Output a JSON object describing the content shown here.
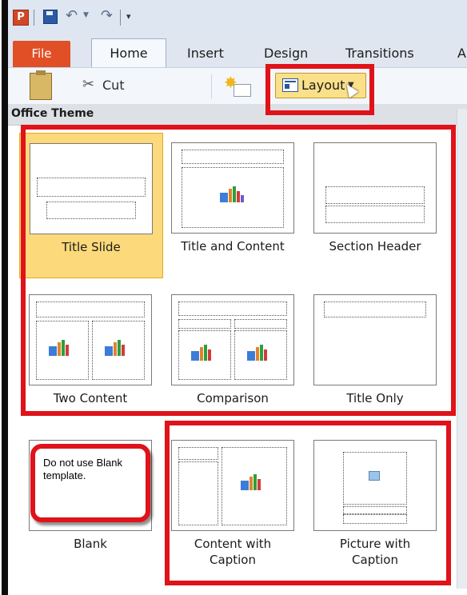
{
  "tabs": {
    "file": "File",
    "home": "Home",
    "insert": "Insert",
    "design": "Design",
    "transitions": "Transitions",
    "partial": "A"
  },
  "ribbon": {
    "cut_label": "Cut",
    "layout_label": "Layout"
  },
  "gallery": {
    "title": "Office Theme",
    "layouts": [
      {
        "label": "Title Slide",
        "selected": true
      },
      {
        "label": "Title and Content",
        "selected": false
      },
      {
        "label": "Section Header",
        "selected": false
      },
      {
        "label": "Two Content",
        "selected": false
      },
      {
        "label": "Comparison",
        "selected": false
      },
      {
        "label": "Title Only",
        "selected": false
      },
      {
        "label": "Blank",
        "selected": false
      },
      {
        "label": "Content with Caption",
        "selected": false
      },
      {
        "label": "Picture with Caption",
        "selected": false
      }
    ]
  },
  "annotation": {
    "callout_text": "Do not use Blank template."
  },
  "colors": {
    "highlight_red": "#e0121a",
    "selected_tile": "#fcd97a",
    "file_tab": "#e14f27"
  },
  "icons": [
    "powerpoint-app-icon",
    "save-icon",
    "undo-icon",
    "redo-icon",
    "customize-qat-icon",
    "paste-icon",
    "cut-icon",
    "new-slide-icon",
    "layout-icon"
  ]
}
